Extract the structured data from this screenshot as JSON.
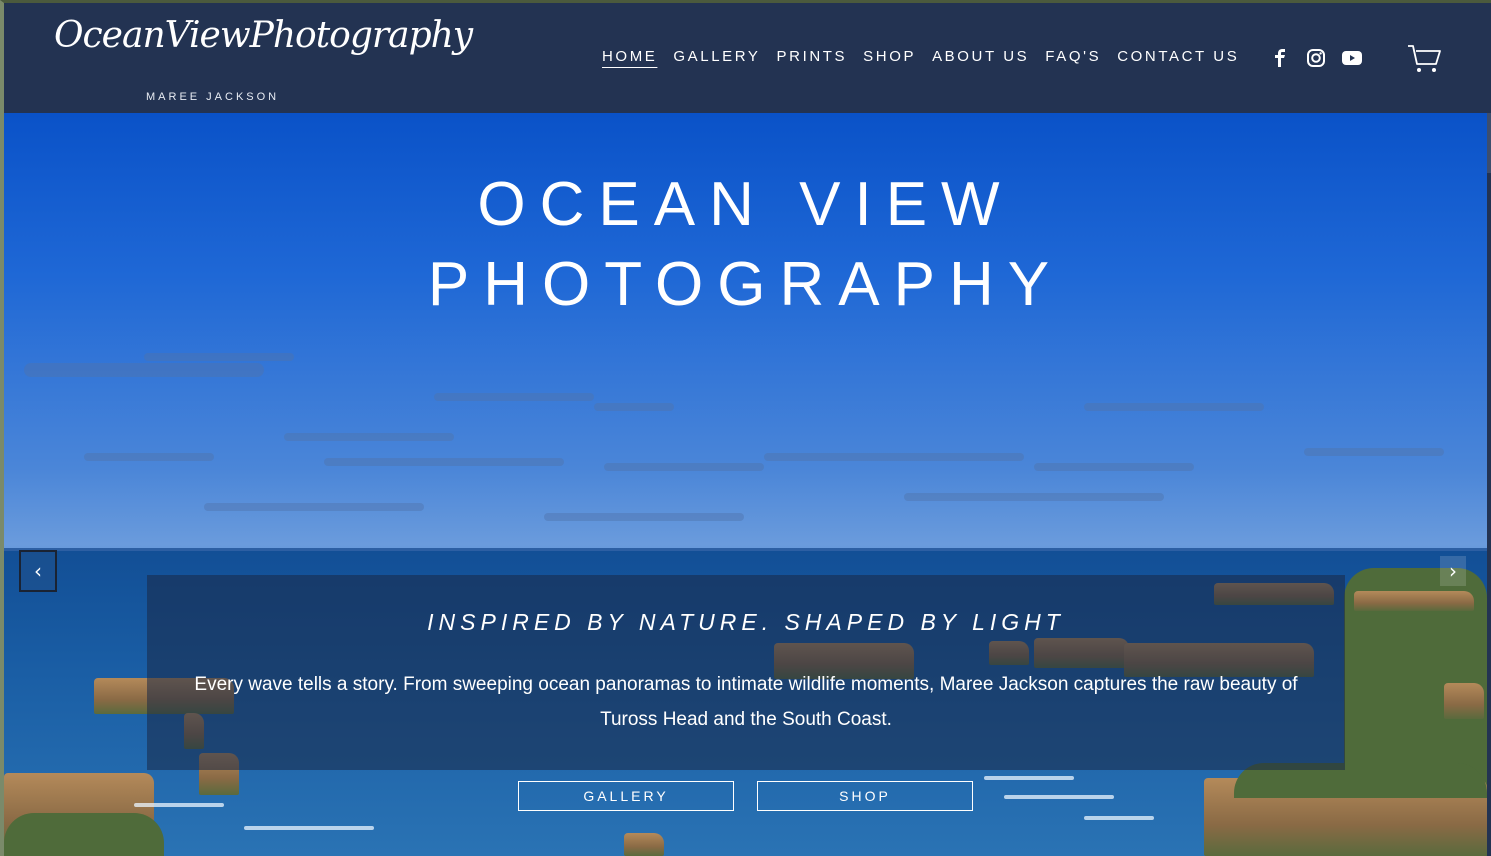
{
  "logo": {
    "script": "OceanViewPhotography",
    "subtitle": "MAREE JACKSON"
  },
  "nav": {
    "items": [
      {
        "label": "HOME",
        "active": true
      },
      {
        "label": "GALLERY",
        "active": false
      },
      {
        "label": "PRINTS",
        "active": false
      },
      {
        "label": "SHOP",
        "active": false
      },
      {
        "label": "ABOUT US",
        "active": false
      },
      {
        "label": "FAQ'S",
        "active": false
      },
      {
        "label": "CONTACT US",
        "active": false
      }
    ]
  },
  "social": {
    "icons": [
      "facebook-icon",
      "instagram-icon",
      "youtube-icon"
    ]
  },
  "cart": {
    "icon": "cart-icon"
  },
  "hero": {
    "title_line1": "OCEAN VIEW",
    "title_line2": "PHOTOGRAPHY",
    "tagline": "INSPIRED BY NATURE. SHAPED BY LIGHT",
    "intro": "Every wave tells a story. From sweeping ocean panoramas to intimate wildlife moments, Maree Jackson captures the raw beauty of Tuross Head and the South Coast.",
    "buttons": {
      "gallery": "GALLERY",
      "shop": "SHOP"
    },
    "prev_arrow": "‹",
    "next_arrow": "›"
  },
  "colors": {
    "header_bg": "#233352",
    "text": "#ffffff",
    "sky": "#1f68d6",
    "sea": "#1a5ea5"
  }
}
